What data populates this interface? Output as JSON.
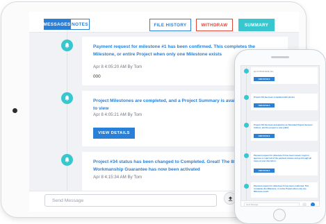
{
  "colors": {
    "accent": "#2a7fd6",
    "teal": "#38c7cf",
    "danger": "#e0453a"
  },
  "tabs": {
    "messages": "MESSAGES",
    "notes": "NOTES"
  },
  "toolbar": {
    "file_history": "FILE HISTORY",
    "withdraw": "WITHDRAW",
    "summary": "SUMMARY"
  },
  "messages": [
    {
      "text": "Payment request for milestone #1 has been confirmed. This completes the Milestone, or entire Project when only one Milestone exists",
      "meta": "Apr 8 4:05:20 AM By Tom",
      "body": "000",
      "icon": "bell-icon"
    },
    {
      "text": "Project Milestones are completed, and a Project Summary is available for you to view",
      "meta": "Apr 8 4:05:21 AM By Tom",
      "button": "VIEW DETAILS",
      "icon": "bell-icon"
    },
    {
      "text": "Project #34 status has been changed to Completed. Great! The 88 Day Workmanship Guarantee has now been activated",
      "meta": "Apr 8 4:15:34 AM By Tom",
      "icon": "bell-icon"
    }
  ],
  "composer": {
    "placeholder": "Send Message",
    "upload_icon": "upload-icon"
  },
  "phone": {
    "messages": [
      {
        "meta": "Apr 8 4:05:20 AM By Tom",
        "button": "VIEW DETAILS"
      },
      {
        "text": "Project #34 has been completed with photos",
        "button": "VIEW DETAILS"
      },
      {
        "text": "Project #34 has been accepted by an Allocated Project Services Advisor, and the project is now public",
        "button": "VIEW DETAILS"
      },
      {
        "text": "Payment request for milestone #1 has been issued. Login to approve or reject all of the payment release and go through all steps at your discretion",
        "button": "VIEW DETAILS"
      },
      {
        "text": "Payment request for milestone #1 has been confirmed. This completes the Milestone, or entire Project when only one Milestone exists"
      }
    ],
    "placeholder": "Send Message"
  }
}
